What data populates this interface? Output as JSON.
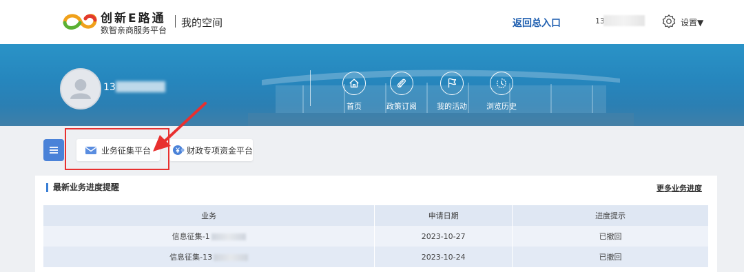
{
  "header": {
    "logo_title": "创新E路通",
    "logo_subtitle": "数智亲商服务平台",
    "space_title": "我的空间",
    "back_link": "返回总入口",
    "user_phone": "13",
    "settings_label": "设置▼"
  },
  "banner": {
    "username": "13",
    "nav": [
      {
        "label": "首页",
        "icon": "home-icon"
      },
      {
        "label": "政策订阅",
        "icon": "paperclip-icon"
      },
      {
        "label": "我的活动",
        "icon": "flag-icon"
      },
      {
        "label": "浏览历史",
        "icon": "clock-icon"
      }
    ]
  },
  "platforms": [
    {
      "label": "业务征集平台",
      "icon": "envelope-icon"
    },
    {
      "label": "财政专项资金平台",
      "icon": "yuan-icon"
    }
  ],
  "progress": {
    "title": "最新业务进度提醒",
    "more_link": "更多业务进度",
    "columns": [
      "业务",
      "申请日期",
      "进度提示"
    ],
    "rows": [
      {
        "business": "信息征集-1",
        "date": "2023-10-27",
        "status": "已撤回"
      },
      {
        "business": "信息征集-13",
        "date": "2023-10-24",
        "status": "已撤回"
      }
    ]
  },
  "colors": {
    "accent": "#1f5fb0",
    "banner": "#2686bd",
    "highlight": "#e8302f",
    "menu_button": "#4a82d8"
  }
}
